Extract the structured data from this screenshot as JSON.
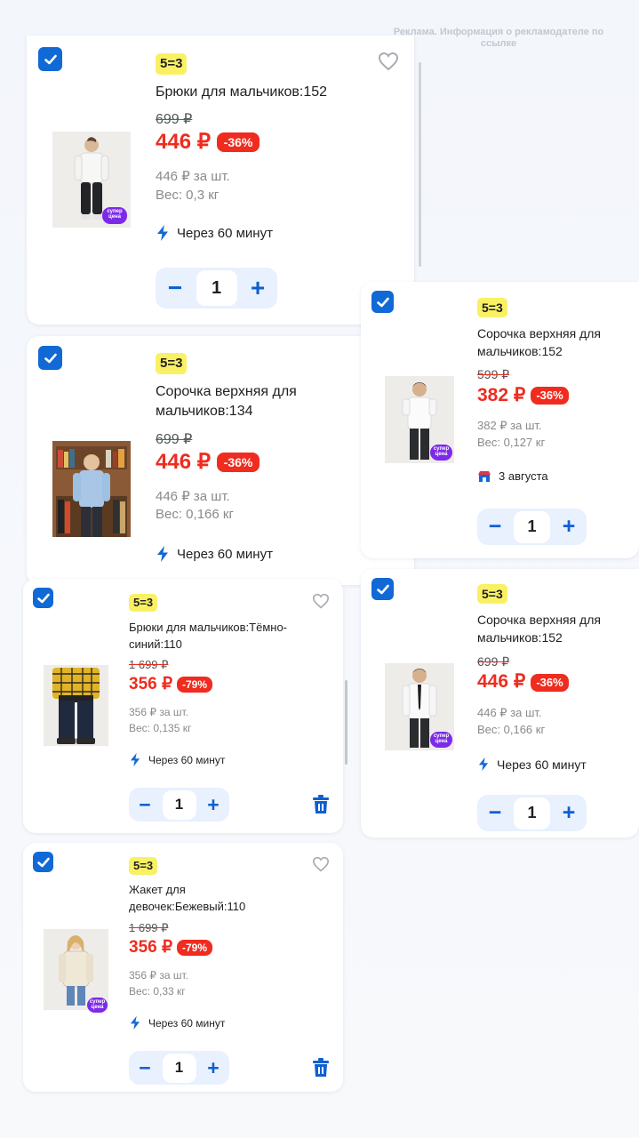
{
  "ad_note": "Реклама. Информация о рекламодателе по ссылке",
  "colors": {
    "accent": "#1169d6",
    "price_red": "#ef2c1f",
    "promo_yellow": "#f9f163"
  },
  "cards": [
    {
      "promo": "5=3",
      "title": "Брюки для мальчиков:152",
      "old_price": "699 ₽",
      "price": "446 ₽",
      "discount": "-36%",
      "unit_price": "446 ₽ за шт.",
      "weight": "Вес: 0,3 кг",
      "delivery": "Через 60 минут",
      "delivery_icon": "lightning-icon",
      "quantity": "1",
      "super_tag": "супер цена",
      "selected": true
    },
    {
      "promo": "5=3",
      "title": "Сорочка верхняя для мальчиков:134",
      "old_price": "699 ₽",
      "price": "446 ₽",
      "discount": "-36%",
      "unit_price": "446 ₽ за шт.",
      "weight": "Вес: 0,166 кг",
      "delivery": "Через 60 минут",
      "delivery_icon": "lightning-icon",
      "selected": true
    },
    {
      "promo": "5=3",
      "title": "Сорочка верхняя для мальчиков:152",
      "old_price": "599 ₽",
      "price": "382 ₽",
      "discount": "-36%",
      "unit_price": "382 ₽ за шт.",
      "weight": "Вес: 0,127 кг",
      "delivery": "3 августа",
      "delivery_icon": "store-icon",
      "quantity": "1",
      "super_tag": "супер цена",
      "selected": true
    },
    {
      "promo": "5=3",
      "title": "Брюки для мальчиков:Тёмно-синий:110",
      "old_price": "1 699 ₽",
      "price": "356 ₽",
      "discount": "-79%",
      "unit_price": "356 ₽ за шт.",
      "weight": "Вес: 0,135 кг",
      "delivery": "Через 60 минут",
      "delivery_icon": "lightning-icon",
      "quantity": "1",
      "selected": true
    },
    {
      "promo": "5=3",
      "title": "Сорочка верхняя для мальчиков:152",
      "old_price": "699 ₽",
      "price": "446 ₽",
      "discount": "-36%",
      "unit_price": "446 ₽ за шт.",
      "weight": "Вес: 0,166 кг",
      "delivery": "Через 60 минут",
      "delivery_icon": "lightning-icon",
      "quantity": "1",
      "super_tag": "супер цена",
      "selected": true
    },
    {
      "promo": "5=3",
      "title": "Жакет для девочек:Бежевый:110",
      "old_price": "1 699 ₽",
      "price": "356 ₽",
      "discount": "-79%",
      "unit_price": "356 ₽ за шт.",
      "weight": "Вес: 0,33 кг",
      "delivery": "Через 60 минут",
      "delivery_icon": "lightning-icon",
      "quantity": "1",
      "super_tag": "супер цена",
      "selected": true
    }
  ]
}
